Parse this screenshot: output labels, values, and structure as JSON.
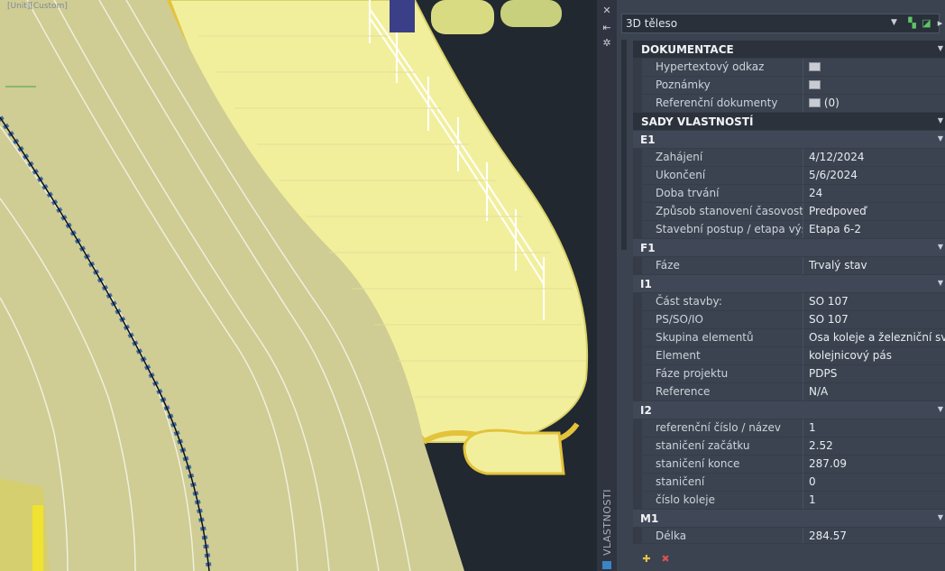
{
  "viewport": {
    "title": "[Unit][Custom]"
  },
  "sidebar": {
    "label": "VLASTNOSTI",
    "icons": [
      "close-icon",
      "auto-hide-icon",
      "settings-icon"
    ]
  },
  "palette": {
    "panel_bg": "#3b4350",
    "category_bg": "#2c323c",
    "subcategory_bg": "#404857",
    "viewport_bg": "#212830",
    "deck_yellow": "#f2ef9c",
    "track_beige": "#cfcc94"
  },
  "selector": {
    "value": "3D těleso"
  },
  "categories": [
    {
      "title": "DOKUMENTACE",
      "props": [
        {
          "label": "Hypertextový odkaz",
          "value": "",
          "icon": "document-icon"
        },
        {
          "label": "Poznámky",
          "value": "",
          "icon": "document-icon"
        },
        {
          "label": "Referenční dokumenty",
          "value": "(0)",
          "icon": "document-icon"
        }
      ]
    },
    {
      "title": "SADY VLASTNOSTÍ"
    }
  ],
  "groups": [
    {
      "title": "E1",
      "props": [
        {
          "label": "Zahájení",
          "value": "4/12/2024"
        },
        {
          "label": "Ukončení",
          "value": "5/6/2024"
        },
        {
          "label": "Doba trvání",
          "value": "24"
        },
        {
          "label": "Způsob stanovení časovosti",
          "value": "Predpoveď"
        },
        {
          "label": "Stavební postup / etapa výst...",
          "value": "Etapa 6-2"
        }
      ]
    },
    {
      "title": "F1",
      "props": [
        {
          "label": "Fáze",
          "value": "Trvalý stav"
        }
      ]
    },
    {
      "title": "I1",
      "props": [
        {
          "label": "Část stavby:",
          "value": "SO 107"
        },
        {
          "label": "PS/SO/IO",
          "value": "SO 107"
        },
        {
          "label": "Skupina elementů",
          "value": "Osa koleje a železniční svršek"
        },
        {
          "label": "Element",
          "value": "kolejnicový pás"
        },
        {
          "label": "Fáze projektu",
          "value": "PDPS"
        },
        {
          "label": "Reference",
          "value": "N/A"
        }
      ]
    },
    {
      "title": "I2",
      "props": [
        {
          "label": "referenční číslo / název",
          "value": "1"
        },
        {
          "label": "staničení začátku",
          "value": "2.52"
        },
        {
          "label": "staničení konce",
          "value": "287.09"
        },
        {
          "label": "staničení",
          "value": "0"
        },
        {
          "label": "číslo koleje",
          "value": "1"
        }
      ]
    },
    {
      "title": "M1",
      "props": [
        {
          "label": "Délka",
          "value": "284.57"
        }
      ]
    }
  ],
  "toolbar": {
    "icons": [
      "toggle-pickadd-icon",
      "select-objects-icon",
      "quick-select-icon"
    ]
  },
  "bottom": {
    "icons": [
      "new-property-set-icon",
      "remove-property-set-icon"
    ]
  }
}
